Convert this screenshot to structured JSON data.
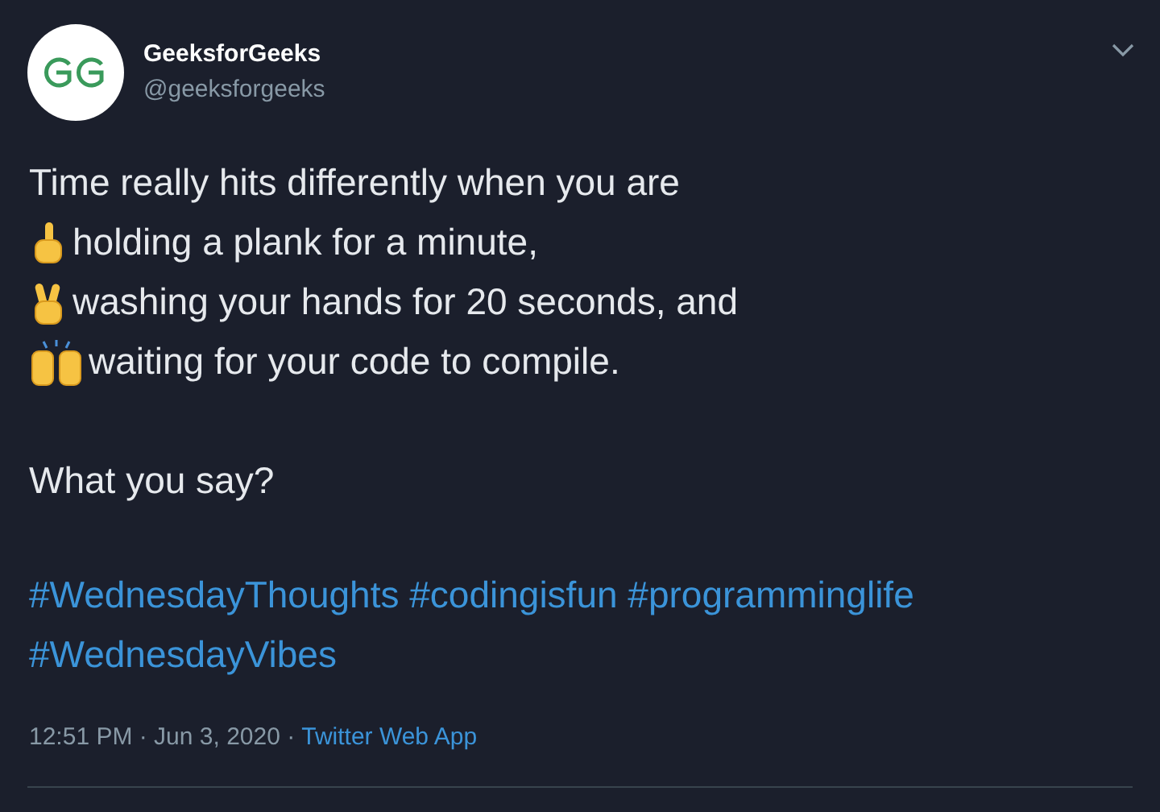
{
  "author": {
    "name": "GeeksforGeeks",
    "handle": "@geeksforgeeks"
  },
  "lines": [
    {
      "kind": "plain",
      "text": "Time really hits differently when you are"
    },
    {
      "kind": "pointing",
      "text": "holding a plank for a minute,"
    },
    {
      "kind": "peace",
      "text": "washing your hands for 20 seconds, and"
    },
    {
      "kind": "raised",
      "text": "waiting for your code to compile."
    }
  ],
  "question": "What you say?",
  "hashtags": [
    "#WednesdayThoughts",
    "#codingisfun",
    "#programminglife",
    "#WednesdayVibes"
  ],
  "meta": {
    "timestamp": "12:51 PM · Jun 3, 2020 ·",
    "source": "Twitter Web App"
  }
}
